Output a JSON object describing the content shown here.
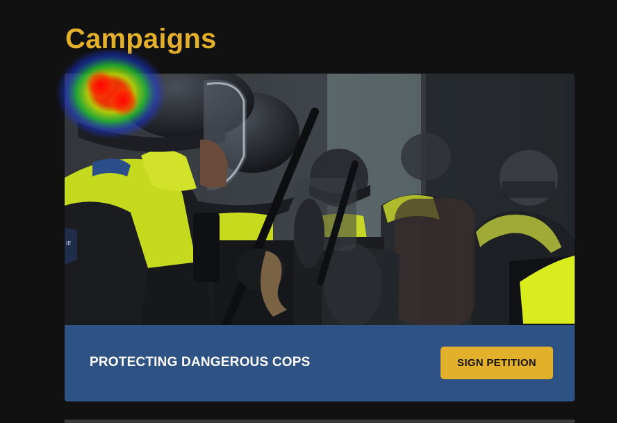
{
  "section": {
    "title": "Campaigns"
  },
  "campaign": {
    "title": "PROTECTING DANGEROUS COPS",
    "button_label": "SIGN PETITION",
    "image_alt": "riot police in helmets holding batons",
    "badge_text": "IE"
  },
  "colors": {
    "background": "#111111",
    "accent": "#e2b02a",
    "card_footer": "#2e5283",
    "text_light": "#ffffff"
  }
}
